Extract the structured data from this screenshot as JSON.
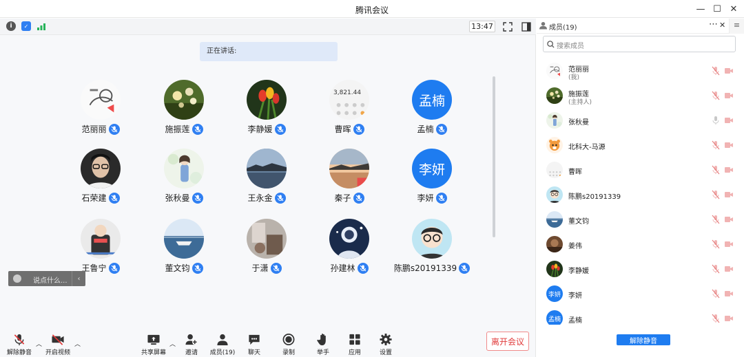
{
  "window": {
    "title": "腾讯会议"
  },
  "topbar": {
    "time": "13:47"
  },
  "speaking_label": "正在讲话:",
  "grid": [
    {
      "name": "范丽丽",
      "avatar": "doodle-avatar",
      "text": ""
    },
    {
      "name": "施振莲",
      "avatar": "flowers-photo",
      "text": ""
    },
    {
      "name": "李静媛",
      "avatar": "tulips-photo",
      "text": ""
    },
    {
      "name": "曹晖",
      "avatar": "calculator-photo",
      "text": "3,821.44"
    },
    {
      "name": "孟楠",
      "avatar": "text-avatar",
      "text": "孟楠"
    },
    {
      "name": "石荣建",
      "avatar": "person-photo",
      "text": ""
    },
    {
      "name": "张秋曼",
      "avatar": "anime-girl",
      "text": ""
    },
    {
      "name": "王永金",
      "avatar": "lake-photo",
      "text": ""
    },
    {
      "name": "秦子",
      "avatar": "sunset-photo",
      "text": ""
    },
    {
      "name": "李妍",
      "avatar": "text-avatar",
      "text": "李妍"
    },
    {
      "name": "王鲁宁",
      "avatar": "figurine-photo",
      "text": ""
    },
    {
      "name": "董文钧",
      "avatar": "sea-photo",
      "text": ""
    },
    {
      "name": "于潇",
      "avatar": "room-photo",
      "text": ""
    },
    {
      "name": "孙建林",
      "avatar": "astronaut-photo",
      "text": ""
    },
    {
      "name": "陈鹏s20191339",
      "avatar": "cartoon-glasses",
      "text": ""
    }
  ],
  "chat": {
    "placeholder": "说点什么..."
  },
  "toolbar": {
    "unmute": "解除静音",
    "video": "开启视频",
    "share": "共享屏幕",
    "invite": "邀请",
    "members": "成员(19)",
    "chat": "聊天",
    "record": "录制",
    "raise_hand": "举手",
    "apps": "应用",
    "settings": "设置",
    "leave": "离开会议"
  },
  "panel": {
    "title": "成员(19)",
    "search_placeholder": "搜索成员",
    "members": [
      {
        "name": "范丽丽",
        "sub": "(我)",
        "avatar": "doodle-avatar",
        "text": ""
      },
      {
        "name": "施振莲",
        "sub": "(主持人)",
        "avatar": "flowers-photo",
        "text": ""
      },
      {
        "name": "张秋曼",
        "sub": "",
        "avatar": "anime-girl",
        "text": ""
      },
      {
        "name": "北科大-马源",
        "sub": "",
        "avatar": "tiger-avatar",
        "text": ""
      },
      {
        "name": "曹晖",
        "sub": "",
        "avatar": "calculator-photo",
        "text": ""
      },
      {
        "name": "陈鹏s20191339",
        "sub": "",
        "avatar": "cartoon-glasses",
        "text": ""
      },
      {
        "name": "董文钧",
        "sub": "",
        "avatar": "sea-photo",
        "text": ""
      },
      {
        "name": "姜伟",
        "sub": "",
        "avatar": "brown-photo",
        "text": ""
      },
      {
        "name": "李静媛",
        "sub": "",
        "avatar": "tulips-photo",
        "text": ""
      },
      {
        "name": "李妍",
        "sub": "",
        "avatar": "text-avatar",
        "text": "李妍"
      },
      {
        "name": "孟楠",
        "sub": "",
        "avatar": "text-avatar",
        "text": "孟楠"
      }
    ],
    "unmute_all": "解除静音"
  },
  "colors": {
    "accent": "#1e7cf0",
    "danger": "#e13b3b",
    "speaking_bg": "#dfe9f9"
  }
}
